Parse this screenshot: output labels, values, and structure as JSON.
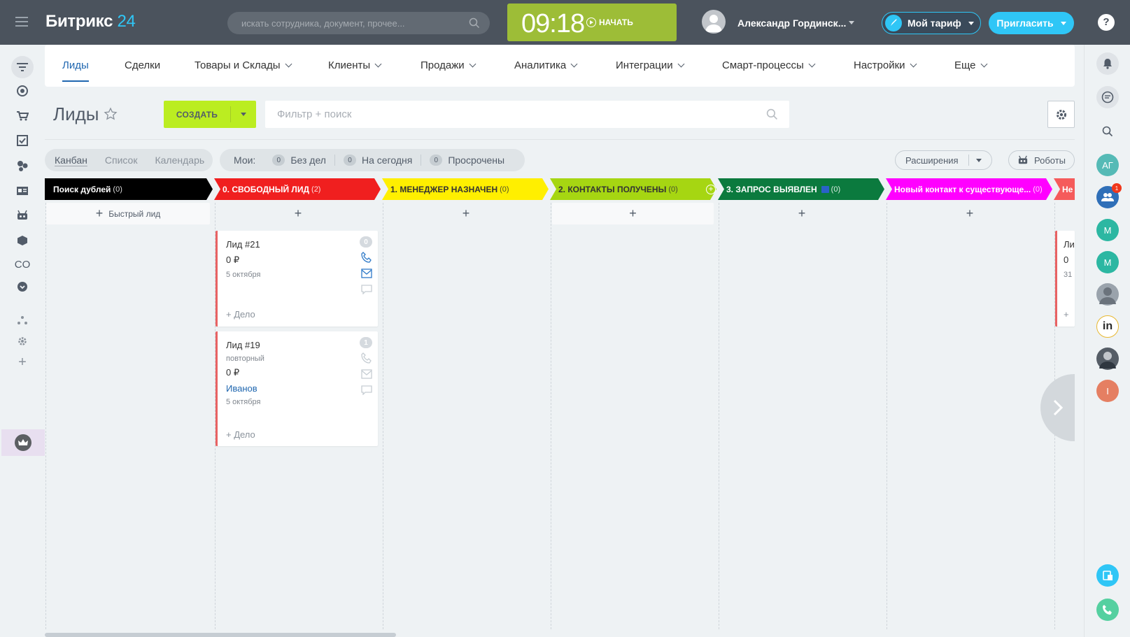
{
  "header": {
    "logo_main": "Битрикс",
    "logo_num": "24",
    "search_placeholder": "искать сотрудника, документ, прочее...",
    "timer": "09:18",
    "timer_start": "НАЧАТЬ",
    "user_name": "Александр Гординск...",
    "tariff": "Мой тариф",
    "invite": "Пригласить",
    "help": "?"
  },
  "nav": {
    "items": [
      {
        "label": "Лиды"
      },
      {
        "label": "Сделки"
      },
      {
        "label": "Товары и Склады"
      },
      {
        "label": "Клиенты"
      },
      {
        "label": "Продажи"
      },
      {
        "label": "Аналитика"
      },
      {
        "label": "Интеграции"
      },
      {
        "label": "Смарт-процессы"
      },
      {
        "label": "Настройки"
      },
      {
        "label": "Еще"
      }
    ]
  },
  "page": {
    "title": "Лиды",
    "create": "СОЗДАТЬ",
    "filter_placeholder": "Фильтр + поиск"
  },
  "views": {
    "kanban": "Канбан",
    "list": "Список",
    "calendar": "Календарь"
  },
  "counters": {
    "mine": "Мои:",
    "no_tasks": {
      "count": "0",
      "label": "Без дел"
    },
    "today": {
      "count": "0",
      "label": "На сегодня"
    },
    "overdue": {
      "count": "0",
      "label": "Просрочены"
    }
  },
  "toolbar": {
    "extensions": "Расширения",
    "robots": "Роботы"
  },
  "stages": [
    {
      "name": "Поиск дублей",
      "count": "(0)",
      "color": "#000000"
    },
    {
      "name": "0. СВОБОДНЫЙ ЛИД",
      "count": "(2)",
      "color": "#f01f1f"
    },
    {
      "name": "1. МЕНЕДЖЕР НАЗНАЧЕН",
      "count": "(0)",
      "color": "#ffef00"
    },
    {
      "name": "2. КОНТАКТЫ ПОЛУЧЕНЫ",
      "count": "(0)",
      "color": "#a6d612"
    },
    {
      "name": "3. ЗАПРОС ВЫЯВЛЕН",
      "count": "(0)",
      "color": "#0b7a3e"
    },
    {
      "name": "Новый контакт к существующе...",
      "count": "(0)",
      "color": "#ff00ff"
    },
    {
      "name": "Не",
      "count": "",
      "color": "#f55b5b"
    }
  ],
  "quick_lead": "Быстрый лид",
  "cards": [
    {
      "title": "Лид #21",
      "price": "0 ₽",
      "date": "5 октября",
      "deal": "+ Дело",
      "badge": "0"
    },
    {
      "title": "Лид #19",
      "subtitle": "повторный",
      "price": "0 ₽",
      "person": "Иванов",
      "date": "5 октября",
      "deal": "+ Дело",
      "badge": "1"
    }
  ],
  "partial_card": {
    "title": "Ли",
    "price": "0 ",
    "date": "31",
    "deal": "+ "
  },
  "rightbar": {
    "avatars": [
      {
        "text": "АГ",
        "color": "#55bab6"
      },
      {
        "text": "М",
        "color": "#2cb7a2"
      },
      {
        "text": "М",
        "color": "#2cb7a2"
      },
      {
        "text": "I",
        "color": "#e57f62"
      }
    ],
    "group_notif": "1"
  }
}
